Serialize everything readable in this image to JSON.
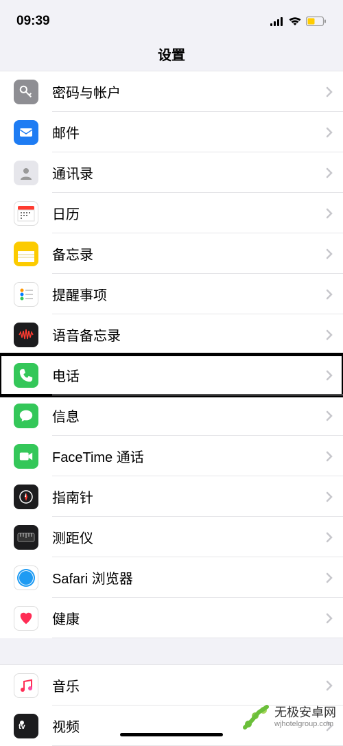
{
  "status": {
    "time": "09:39"
  },
  "nav": {
    "title": "设置"
  },
  "group1": [
    {
      "label": "密码与帐户",
      "bg": "#8e8e93",
      "icon": "key"
    },
    {
      "label": "邮件",
      "bg": "#1e7cf3",
      "icon": "mail"
    },
    {
      "label": "通讯录",
      "bg": "#e6e6eb",
      "icon": "contacts"
    },
    {
      "label": "日历",
      "bg": "#ffffff",
      "icon": "calendar"
    },
    {
      "label": "备忘录",
      "bg": "#fccb00",
      "icon": "notes"
    },
    {
      "label": "提醒事项",
      "bg": "#ffffff",
      "icon": "reminders"
    },
    {
      "label": "语音备忘录",
      "bg": "#1c1c1e",
      "icon": "voice"
    },
    {
      "label": "电话",
      "bg": "#34c759",
      "icon": "phone",
      "highlighted": true
    },
    {
      "label": "信息",
      "bg": "#34c759",
      "icon": "message"
    },
    {
      "label": "FaceTime 通话",
      "bg": "#34c759",
      "icon": "facetime"
    },
    {
      "label": "指南针",
      "bg": "#1c1c1e",
      "icon": "compass"
    },
    {
      "label": "测距仪",
      "bg": "#1c1c1e",
      "icon": "measure"
    },
    {
      "label": "Safari 浏览器",
      "bg": "#ffffff",
      "icon": "safari"
    },
    {
      "label": "健康",
      "bg": "#ffffff",
      "icon": "health"
    }
  ],
  "group2": [
    {
      "label": "音乐",
      "bg": "#ffffff",
      "icon": "music"
    },
    {
      "label": "视频",
      "bg": "#1c1c1e",
      "icon": "tv"
    }
  ],
  "watermark": {
    "title": "无极安卓网",
    "sub": "wjhotelgroup.com"
  }
}
